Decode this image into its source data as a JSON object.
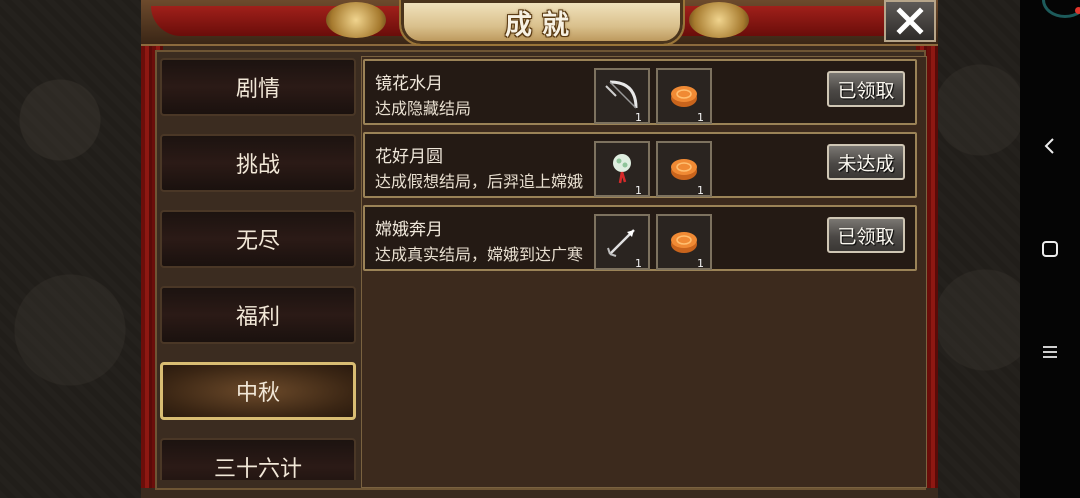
{
  "window": {
    "title": "成就",
    "close_icon": "close-x-icon"
  },
  "categories": [
    {
      "label": "剧情",
      "active": false
    },
    {
      "label": "挑战",
      "active": false
    },
    {
      "label": "无尽",
      "active": false
    },
    {
      "label": "福利",
      "active": false
    },
    {
      "label": "中秋",
      "active": true
    },
    {
      "label": "三十六计",
      "active": false
    }
  ],
  "achievements": [
    {
      "title": "镜花水月",
      "desc": "达成隐藏结局",
      "rewards": [
        {
          "icon": "bow-icon",
          "qty": "1"
        },
        {
          "icon": "mooncake-icon",
          "qty": "1"
        }
      ],
      "status": "已领取"
    },
    {
      "title": "花好月圆",
      "desc": "达成假想结局，后羿追上嫦娥",
      "rewards": [
        {
          "icon": "jade-pendant-icon",
          "qty": "1"
        },
        {
          "icon": "mooncake-icon",
          "qty": "1"
        }
      ],
      "status": "未达成"
    },
    {
      "title": "嫦娥奔月",
      "desc": "达成真实结局，嫦娥到达广寒",
      "rewards": [
        {
          "icon": "arrow-icon",
          "qty": "1"
        },
        {
          "icon": "mooncake-icon",
          "qty": "1"
        }
      ],
      "status": "已领取"
    }
  ],
  "system_nav": {
    "back_icon": "back-chevron-icon",
    "home_icon": "home-square-icon",
    "menu_icon": "menu-lines-icon"
  },
  "colors": {
    "accent_gold": "#d9bd73",
    "curtain_red": "#8e1812"
  }
}
